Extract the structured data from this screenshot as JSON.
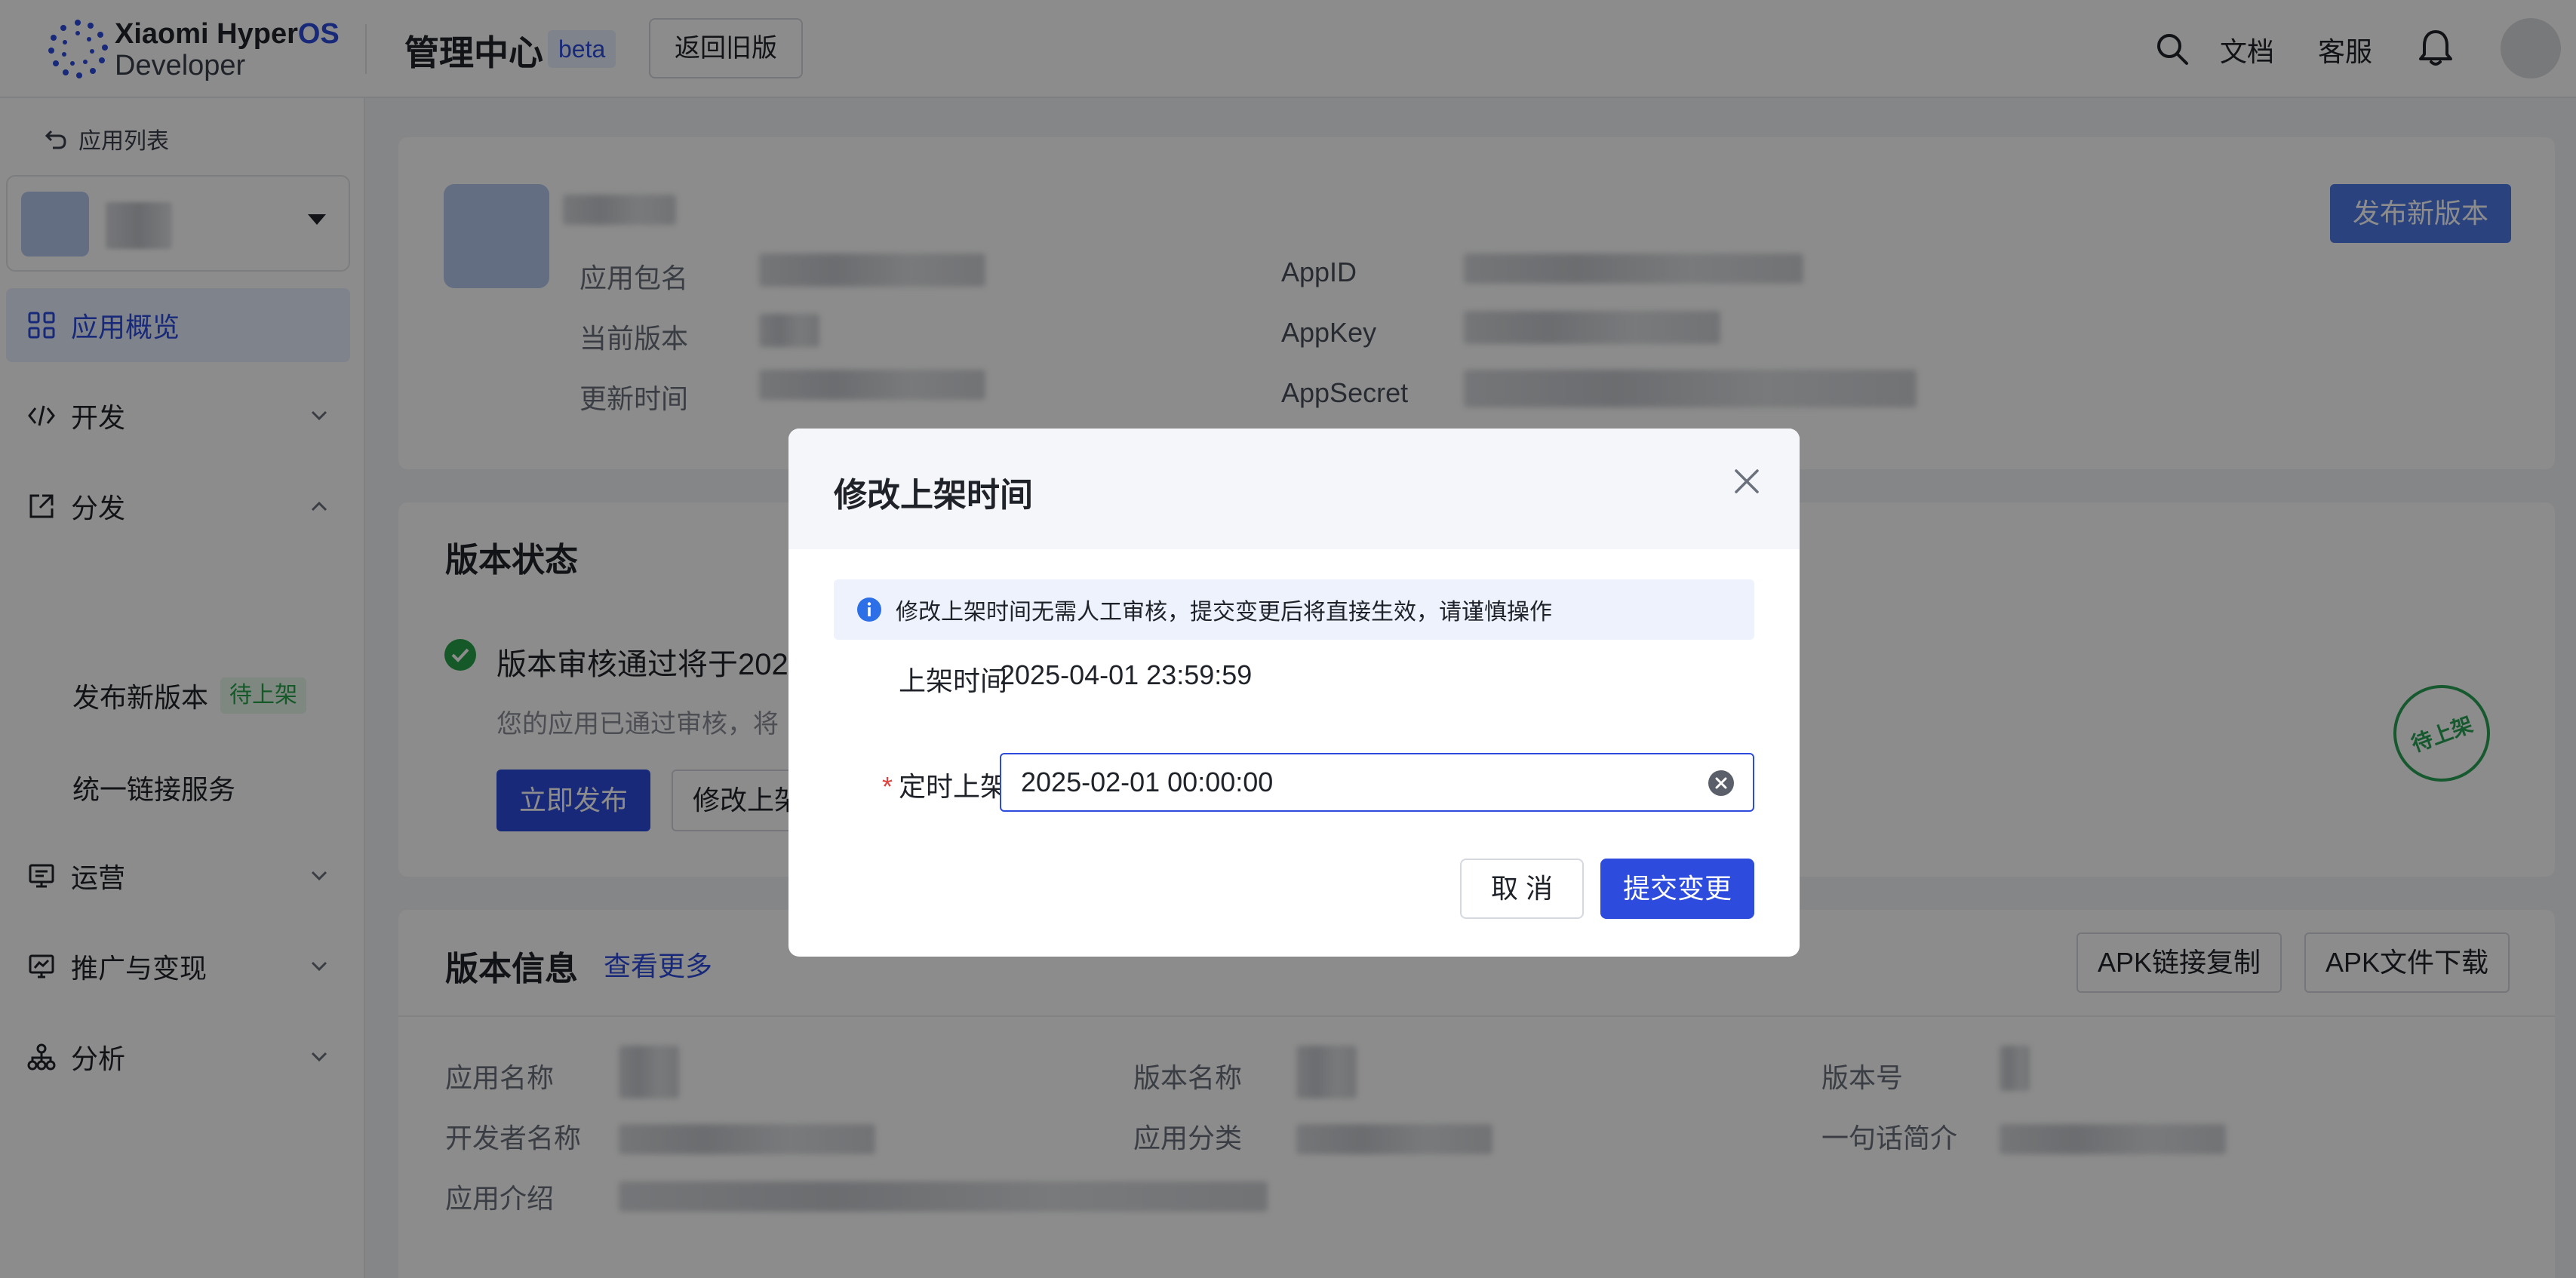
{
  "header": {
    "brand_line1_main": "Xiaomi Hyper",
    "brand_line1_accent": "OS",
    "brand_line2": "Developer",
    "title": "管理中心",
    "beta_badge": "beta",
    "old_version_button": "返回旧版",
    "docs": "文档",
    "support": "客服",
    "icons": [
      "search-icon",
      "bell-icon",
      "avatar"
    ]
  },
  "sidebar": {
    "back_label": "应用列表",
    "items": [
      {
        "label": "应用概览",
        "icon": "grid-icon",
        "active": true
      },
      {
        "label": "开发",
        "icon": "code-icon"
      },
      {
        "label": "分发",
        "icon": "share-icon",
        "expanded": true
      },
      {
        "label": "运营",
        "icon": "monitor-icon"
      },
      {
        "label": "推广与变现",
        "icon": "chart-board-icon"
      },
      {
        "label": "分析",
        "icon": "org-icon"
      }
    ],
    "sub_items": [
      {
        "label": "发布新版本",
        "tag": "待上架"
      },
      {
        "label": "统一链接服务"
      }
    ]
  },
  "app_info": {
    "labels": [
      "应用包名",
      "当前版本",
      "更新时间"
    ],
    "right_labels": [
      "AppID",
      "AppKey",
      "AppSecret"
    ],
    "publish_button": "发布新版本"
  },
  "version_status": {
    "title": "版本状态",
    "status_text": "版本审核通过将于202",
    "desc": "您的应用已通过审核，将",
    "publish_now": "立即发布",
    "modify_button": "修改上架",
    "stamp": "待上架"
  },
  "version_info": {
    "title": "版本信息",
    "more_link": "查看更多",
    "apk_copy": "APK链接复制",
    "apk_download": "APK文件下载",
    "labels_col1": [
      "应用名称",
      "开发者名称",
      "应用介绍"
    ],
    "labels_col2": [
      "版本名称",
      "应用分类"
    ],
    "labels_col3": [
      "版本号",
      "一句话简介"
    ]
  },
  "modal": {
    "title": "修改上架时间",
    "notice": "修改上架时间无需人工审核，提交变更后将直接生效，请谨慎操作",
    "field1_label": "上架时间",
    "field1_value": "2025-04-01 23:59:59",
    "field2_label": "定时上架",
    "field2_required_mark": "*",
    "field2_value": "2025-02-01 00:00:00",
    "cancel": "取 消",
    "submit": "提交变更"
  },
  "colors": {
    "primary": "#2d4bdc",
    "success": "#27a34a",
    "required": "#e0443e"
  }
}
